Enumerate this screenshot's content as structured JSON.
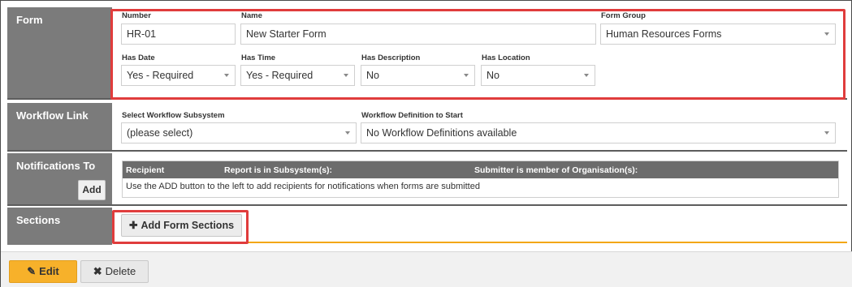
{
  "form": {
    "section_label": "Form",
    "number_label": "Number",
    "number_value": "HR-01",
    "name_label": "Name",
    "name_value": "New Starter Form",
    "form_group_label": "Form Group",
    "form_group_value": "Human Resources Forms",
    "has_date_label": "Has Date",
    "has_date_value": "Yes - Required",
    "has_time_label": "Has Time",
    "has_time_value": "Yes - Required",
    "has_description_label": "Has Description",
    "has_description_value": "No",
    "has_location_label": "Has Location",
    "has_location_value": "No"
  },
  "workflow": {
    "section_label": "Workflow Link",
    "subsystem_label": "Select Workflow Subsystem",
    "subsystem_value": "(please select)",
    "definition_label": "Workflow Definition to Start",
    "definition_value": "No Workflow Definitions available"
  },
  "notifications": {
    "section_label": "Notifications To",
    "add_label": "Add",
    "columns": [
      "Recipient",
      "Report is in Subsystem(s):",
      "Submitter is member of Organisation(s):"
    ],
    "empty_message": "Use the ADD button to the left to add recipients for notifications when forms are submitted"
  },
  "sections": {
    "section_label": "Sections",
    "add_sections_label": "Add Form Sections",
    "add_icon": "plus-icon"
  },
  "footer": {
    "edit_label": "Edit",
    "edit_icon": "edit-icon",
    "delete_label": "Delete",
    "delete_icon": "close-icon"
  },
  "colors": {
    "highlight": "#e03c3c",
    "accent": "#f3a712",
    "label_bg": "#7b7b7b"
  }
}
